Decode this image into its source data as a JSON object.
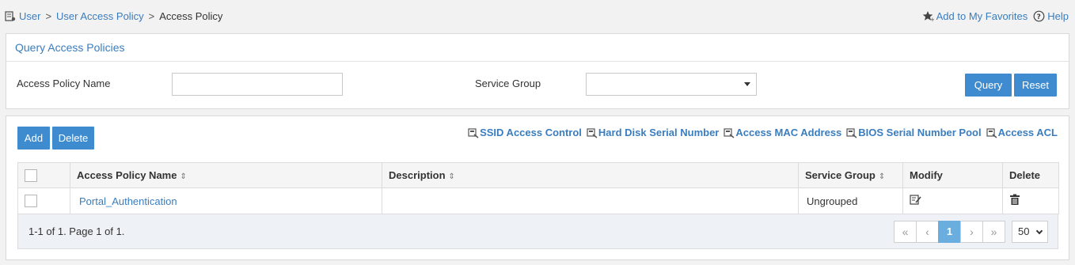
{
  "breadcrumb": {
    "items": [
      "User",
      "User Access Policy"
    ],
    "current": "Access Policy",
    "separator": ">"
  },
  "header_actions": {
    "favorites": "Add to My Favorites",
    "help": "Help"
  },
  "query": {
    "title": "Query Access Policies",
    "name_label": "Access Policy Name",
    "name_value": "",
    "group_label": "Service Group",
    "group_value": "",
    "query_button": "Query",
    "reset_button": "Reset"
  },
  "list": {
    "add_button": "Add",
    "delete_button": "Delete",
    "links": [
      "SSID Access Control",
      "Hard Disk Serial Number",
      "Access MAC Address",
      "BIOS Serial Number Pool",
      "Access ACL"
    ],
    "columns": {
      "name": "Access Policy Name",
      "description": "Description",
      "group": "Service Group",
      "modify": "Modify",
      "delete": "Delete"
    },
    "rows": [
      {
        "name": "Portal_Authentication",
        "description": "",
        "group": "Ungrouped"
      }
    ],
    "pagination": {
      "info": "1-1 of 1. Page 1 of 1.",
      "current_page": "1",
      "first": "«",
      "prev": "‹",
      "next": "›",
      "last": "»",
      "page_size": "50"
    }
  },
  "colors": {
    "accent": "#3e8ccf",
    "link": "#3a7dbf",
    "active_page": "#6aaee0"
  }
}
